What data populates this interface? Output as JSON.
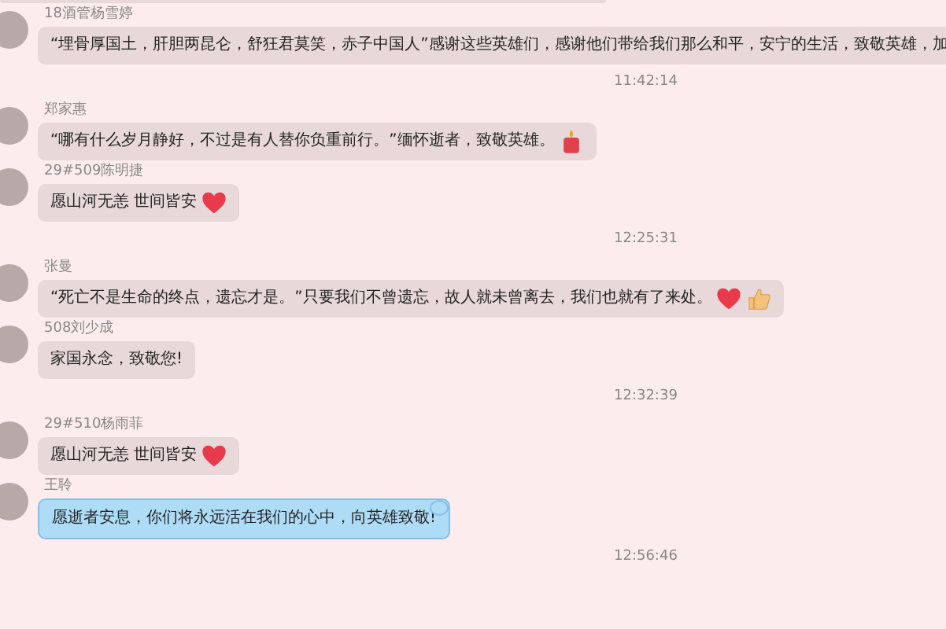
{
  "messages": [
    {
      "kind": "message",
      "sender": "18酒管杨雪婷",
      "text": "“埋骨厚国土，肝胆两昆仑，舒狂君莫笑，赤子中国人”感谢这些英雄们，感谢他们带给我们那么和平，安宁的生活，致敬英雄，加"
    },
    {
      "kind": "time",
      "text": "11:42:14"
    },
    {
      "kind": "message",
      "sender": "郑家惠",
      "text": "“哪有什么岁月静好，不过是有人替你负重前行。”缅怀逝者，致敬英雄。",
      "emojis": [
        {
          "kind": "candle"
        }
      ]
    },
    {
      "kind": "message",
      "sender": "29#509陈明捷",
      "text": "愿山河无恙  世间皆安",
      "emojis": [
        {
          "kind": "heart"
        }
      ]
    },
    {
      "kind": "time",
      "text": "12:25:31"
    },
    {
      "kind": "message",
      "sender": "张曼",
      "text": "“死亡不是生命的终点，遗忘才是。”只要我们不曾遗忘，故人就未曾离去，我们也就有了来处。",
      "emojis": [
        {
          "kind": "heart"
        },
        {
          "kind": "thumb"
        }
      ]
    },
    {
      "kind": "message",
      "sender": "508刘少成",
      "text": "家国永念，致敬您!"
    },
    {
      "kind": "time",
      "text": "12:32:39"
    },
    {
      "kind": "message",
      "sender": "29#510杨雨菲",
      "text": "愿山河无恙  世间皆安",
      "emojis": [
        {
          "kind": "heart"
        }
      ]
    },
    {
      "kind": "bubble_message",
      "sender": "王聆",
      "text": "愿逝者安息，你们将永远活在我们的心中，向英雄致敬!"
    },
    {
      "kind": "time",
      "text": "12:56:46"
    }
  ]
}
